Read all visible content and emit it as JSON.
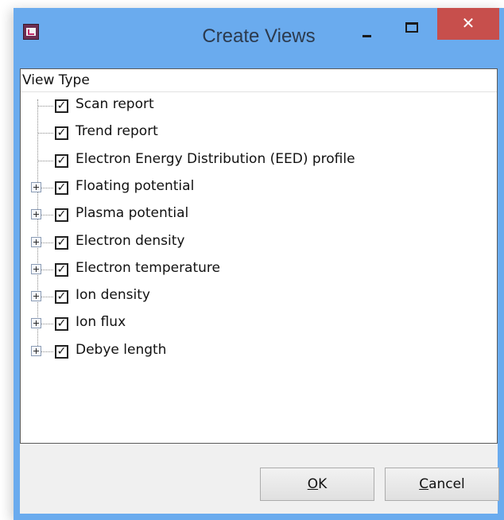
{
  "window": {
    "title": "Create Views",
    "close_glyph": "✕"
  },
  "tree": {
    "header": "View Type",
    "items": [
      {
        "label": "Scan report",
        "checked": true,
        "expandable": false
      },
      {
        "label": "Trend report",
        "checked": true,
        "expandable": false
      },
      {
        "label": "Electron Energy Distribution (EED) profile",
        "checked": true,
        "expandable": false
      },
      {
        "label": "Floating potential",
        "checked": true,
        "expandable": true
      },
      {
        "label": "Plasma potential",
        "checked": true,
        "expandable": true
      },
      {
        "label": "Electron density",
        "checked": true,
        "expandable": true
      },
      {
        "label": "Electron temperature",
        "checked": true,
        "expandable": true
      },
      {
        "label": "Ion density",
        "checked": true,
        "expandable": true
      },
      {
        "label": "Ion flux",
        "checked": true,
        "expandable": true
      },
      {
        "label": "Debye length",
        "checked": true,
        "expandable": true
      }
    ],
    "check_glyph": "✓"
  },
  "buttons": {
    "ok": {
      "mnemonic": "O",
      "rest": "K"
    },
    "cancel": {
      "mnemonic": "C",
      "rest": "ancel"
    }
  },
  "colors": {
    "titlebar": "#6aabee",
    "close": "#c74f4c"
  }
}
